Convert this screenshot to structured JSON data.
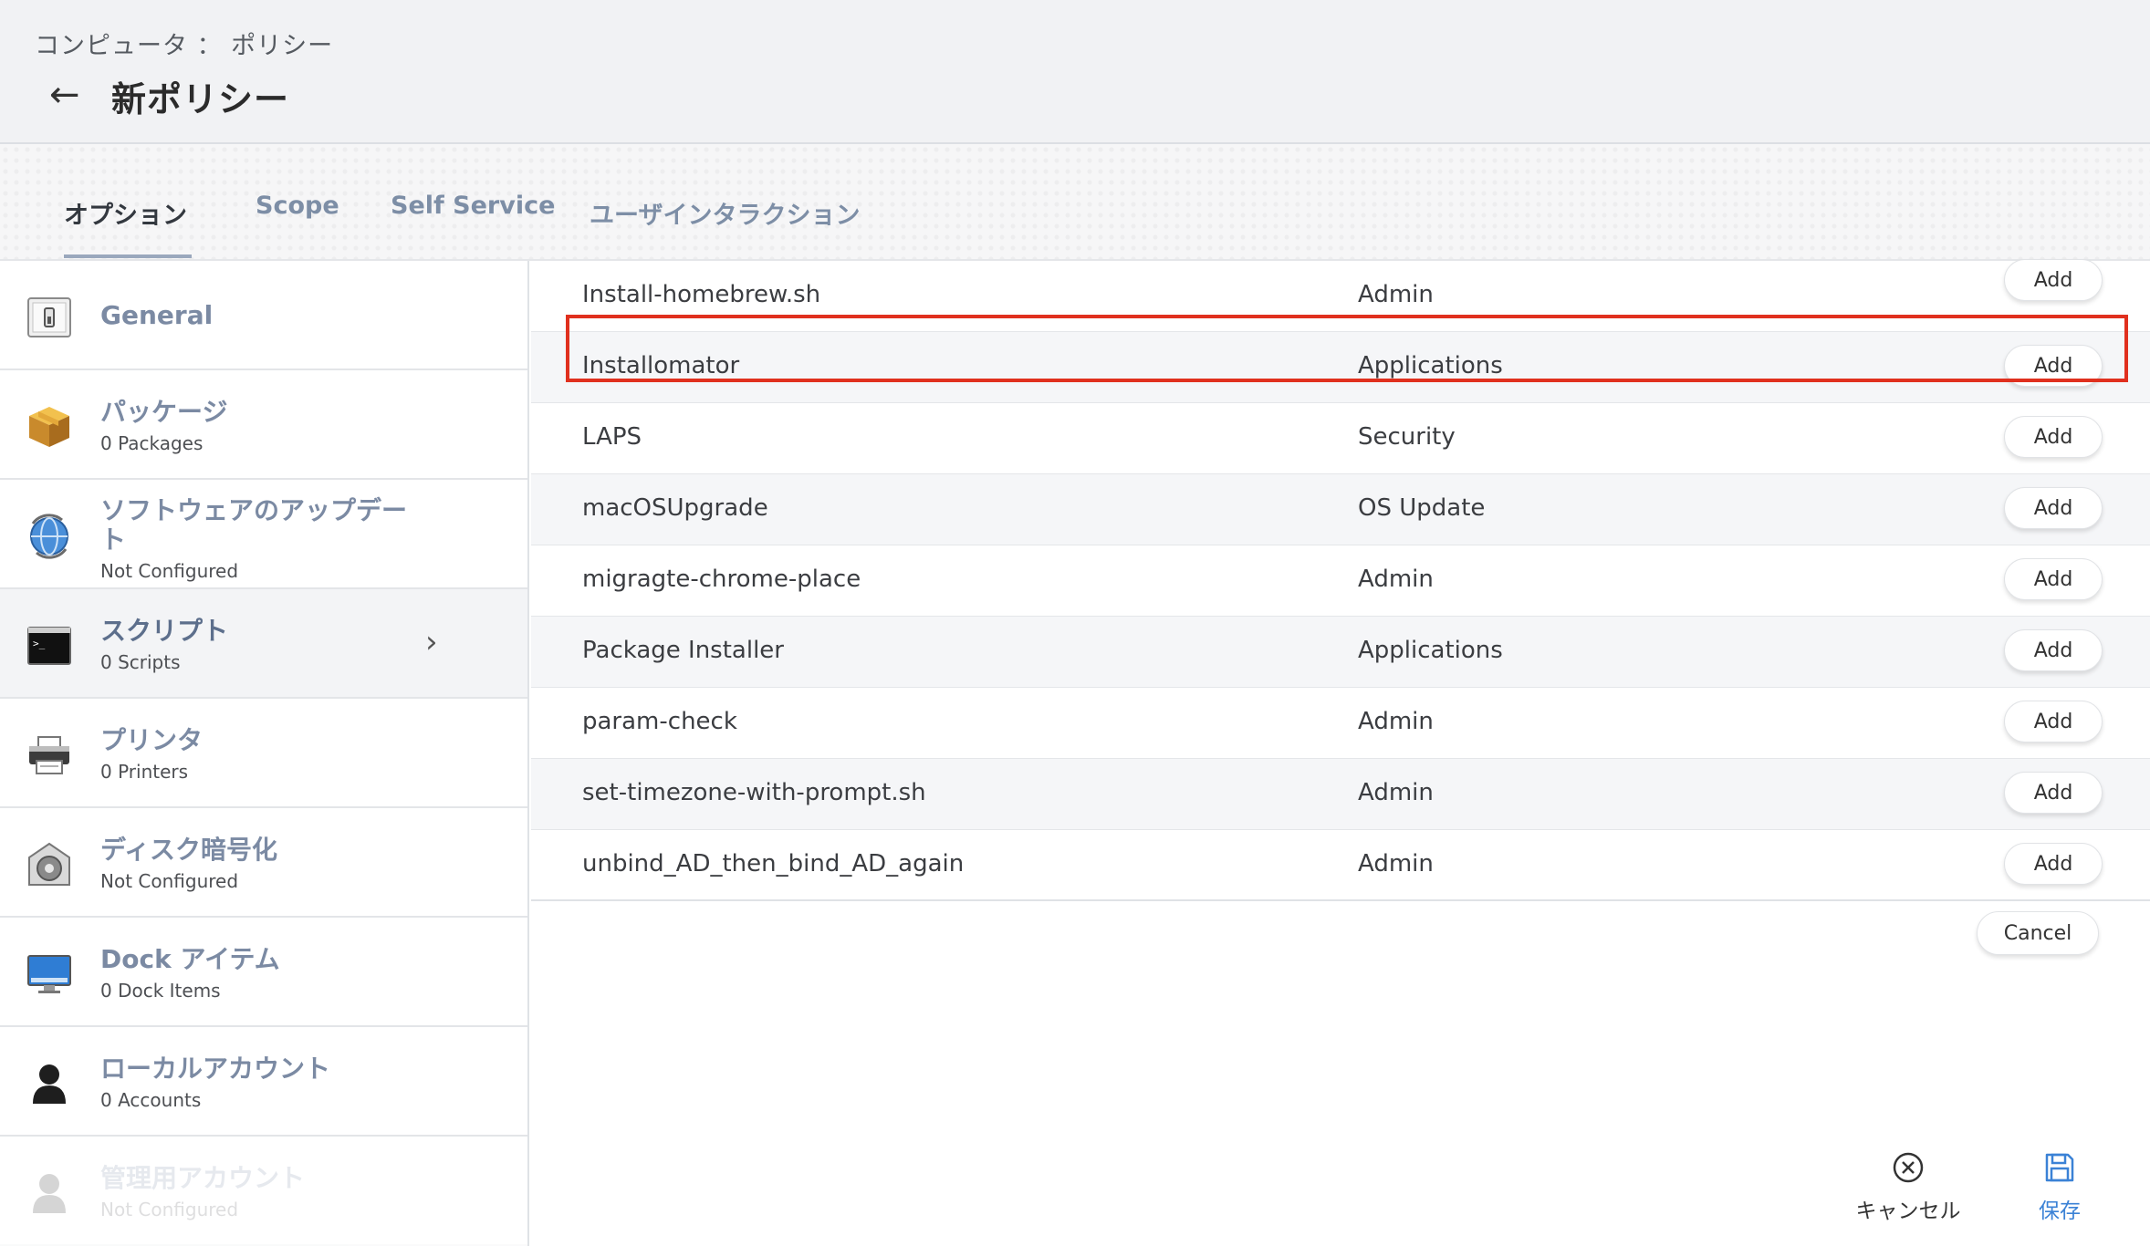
{
  "header": {
    "breadcrumb": "コンピュータ ： ポリシー",
    "title": "新ポリシー"
  },
  "tabs": [
    {
      "label": "オプション",
      "active": true
    },
    {
      "label": "Scope",
      "active": false
    },
    {
      "label": "Self Service",
      "active": false
    },
    {
      "label": "ユーザインタラクション",
      "active": false
    }
  ],
  "sidebar": {
    "items": [
      {
        "label": "General",
        "sub": "",
        "icon": "general-switch-icon"
      },
      {
        "label": "パッケージ",
        "sub": "0 Packages",
        "icon": "package-box-icon"
      },
      {
        "label": "ソフトウェアのアップデー\nト",
        "sub": "Not Configured",
        "icon": "software-update-globe-icon"
      },
      {
        "label": "スクリプト",
        "sub": "0 Scripts",
        "icon": "terminal-icon",
        "selected": true
      },
      {
        "label": "プリンタ",
        "sub": "0 Printers",
        "icon": "printer-icon"
      },
      {
        "label": "ディスク暗号化",
        "sub": "Not Configured",
        "icon": "disk-encryption-icon"
      },
      {
        "label": "Dock アイテム",
        "sub": "0 Dock Items",
        "icon": "dock-monitor-icon"
      },
      {
        "label": "ローカルアカウント",
        "sub": "0 Accounts",
        "icon": "local-account-person-icon"
      },
      {
        "label": "管理用アカウント",
        "sub": "Not Configured",
        "icon": "management-account-person-icon"
      }
    ]
  },
  "scripts": {
    "add_label": "Add",
    "rows": [
      {
        "name": "Install-homebrew.sh",
        "category": "Admin"
      },
      {
        "name": "Installomator",
        "category": "Applications",
        "highlighted": true
      },
      {
        "name": "LAPS",
        "category": "Security"
      },
      {
        "name": "macOSUpgrade",
        "category": "OS Update"
      },
      {
        "name": "migragte-chrome-place",
        "category": "Admin"
      },
      {
        "name": "Package Installer",
        "category": "Applications"
      },
      {
        "name": "param-check",
        "category": "Admin"
      },
      {
        "name": "set-timezone-with-prompt.sh",
        "category": "Admin"
      },
      {
        "name": "unbind_AD_then_bind_AD_again",
        "category": "Admin"
      }
    ],
    "cancel_label": "Cancel"
  },
  "footer": {
    "cancel_label": "キャンセル",
    "save_label": "保存"
  },
  "colors": {
    "accent": "#3b82d6",
    "highlight": "#e0301e",
    "sidebar_label": "#7b8aa3"
  }
}
